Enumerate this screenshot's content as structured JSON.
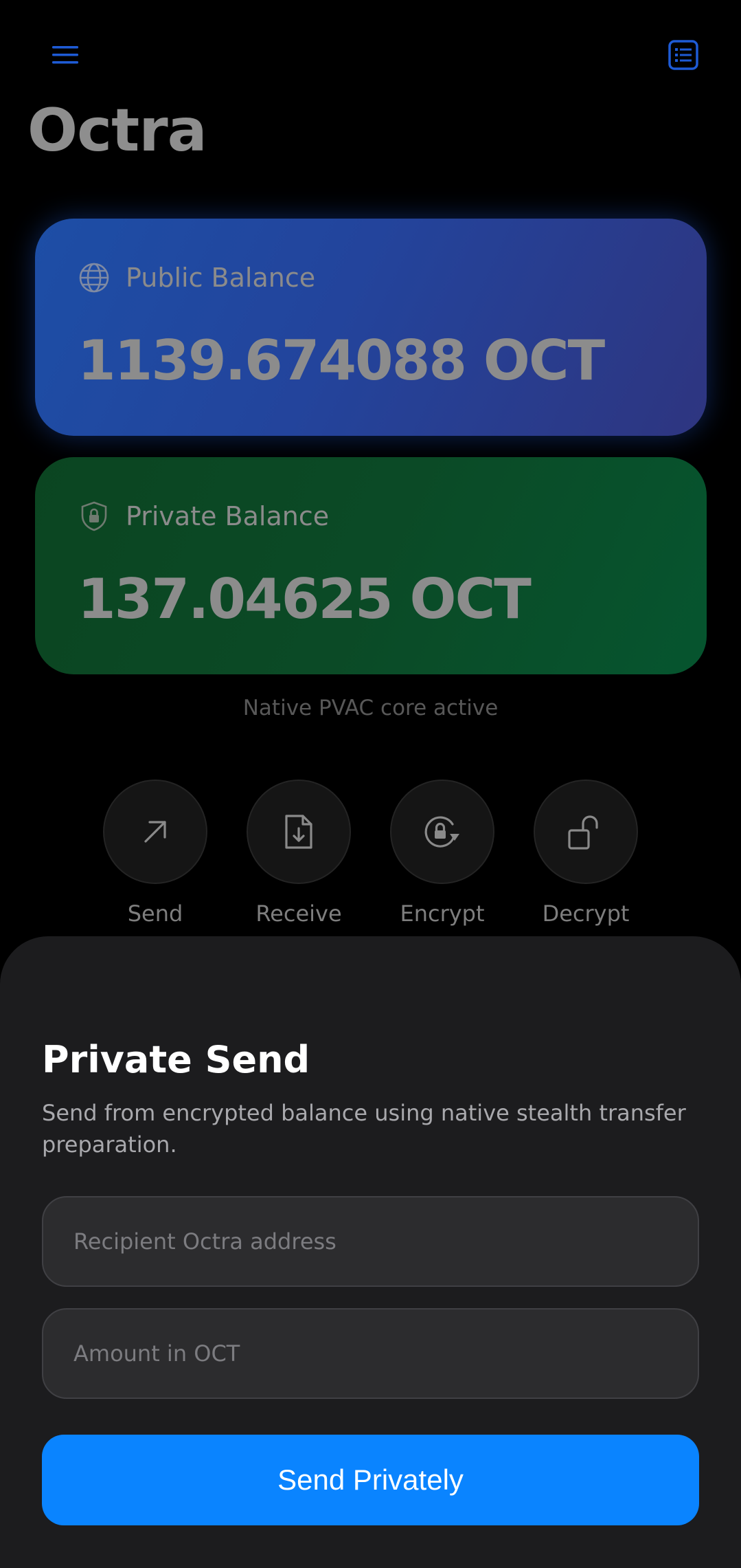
{
  "header": {
    "title": "Octra",
    "menu_icon": "hamburger-menu-icon",
    "list_icon": "list-icon",
    "accent_color": "#1e5bd6"
  },
  "balances": {
    "public": {
      "label": "Public Balance",
      "amount": "1139.674088 OCT",
      "icon": "globe-icon"
    },
    "private": {
      "label": "Private Balance",
      "amount": "137.04625 OCT",
      "icon": "shield-lock-icon"
    }
  },
  "status": {
    "text": "Native PVAC core active"
  },
  "actions": [
    {
      "label": "Send",
      "icon": "arrow-up-right-icon"
    },
    {
      "label": "Receive",
      "icon": "file-download-icon"
    },
    {
      "label": "Encrypt",
      "icon": "lock-rotate-icon"
    },
    {
      "label": "Decrypt",
      "icon": "unlock-icon"
    }
  ],
  "private_send": {
    "title": "Private Send",
    "description": "Send from encrypted balance using native stealth transfer preparation.",
    "recipient_placeholder": "Recipient Octra address",
    "amount_placeholder": "Amount in OCT",
    "button_label": "Send Privately",
    "button_color": "#0a84ff"
  }
}
